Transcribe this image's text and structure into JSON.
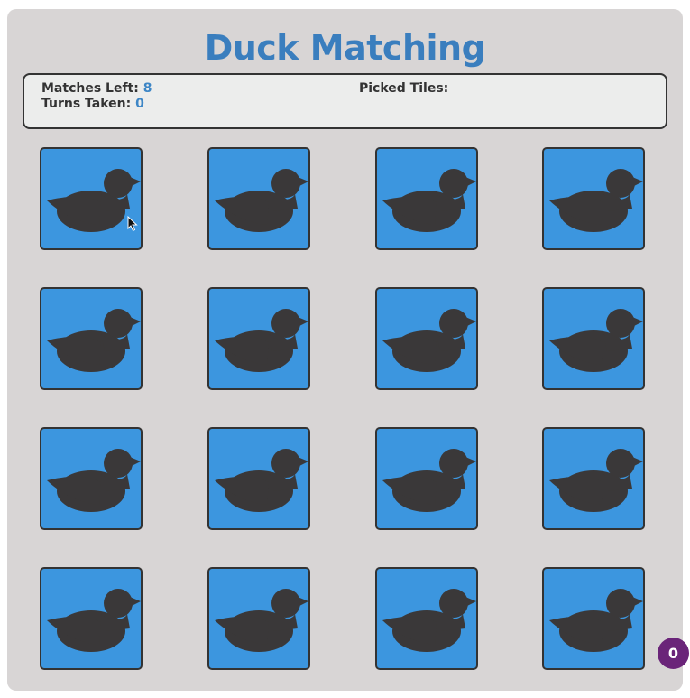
{
  "title": "Duck Matching",
  "scoreboard": {
    "matches_left_label": "Matches Left:",
    "matches_left_value": "8",
    "turns_taken_label": "Turns Taken:",
    "turns_taken_value": "0",
    "picked_tiles_label": "Picked Tiles:"
  },
  "tiles": {
    "count": 16,
    "icon": "duck-icon",
    "face": "down"
  },
  "badge": {
    "value": "0"
  },
  "colors": {
    "panel": "#d8d5d5",
    "title": "#3a7ebe",
    "tile": "#3c96df",
    "duck": "#3a3839",
    "accent_value": "#3d86c6",
    "badge": "#6a2479"
  }
}
